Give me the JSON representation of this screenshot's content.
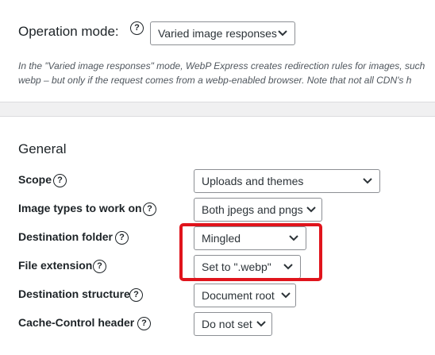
{
  "operation": {
    "label": "Operation mode:",
    "help": "?",
    "selected": "Varied image responses",
    "description_line1": "In the \"Varied image responses\" mode, WebP Express creates redirection rules for images, such",
    "description_line2": "webp – but only if the request comes from a webp-enabled browser. Note that not all CDN's h"
  },
  "general": {
    "title": "General",
    "rows": [
      {
        "label": "Scope",
        "help": "?",
        "value": "Uploads and themes"
      },
      {
        "label": "Image types to work on",
        "help": "?",
        "value": "Both jpegs and pngs"
      },
      {
        "label": "Destination folder",
        "help": "?",
        "value": "Mingled"
      },
      {
        "label": "File extension",
        "help": "?",
        "value": "Set to \".webp\""
      },
      {
        "label": "Destination structure",
        "help": "?",
        "value": "Document root"
      },
      {
        "label": "Cache-Control header",
        "help": "?",
        "value": "Do not set"
      }
    ]
  },
  "colors": {
    "highlight": "#e0141c",
    "text": "#1d2327",
    "border": "#8c8f94"
  },
  "icons": {
    "help": "question-circle-icon",
    "dropdown": "chevron-down-icon"
  }
}
